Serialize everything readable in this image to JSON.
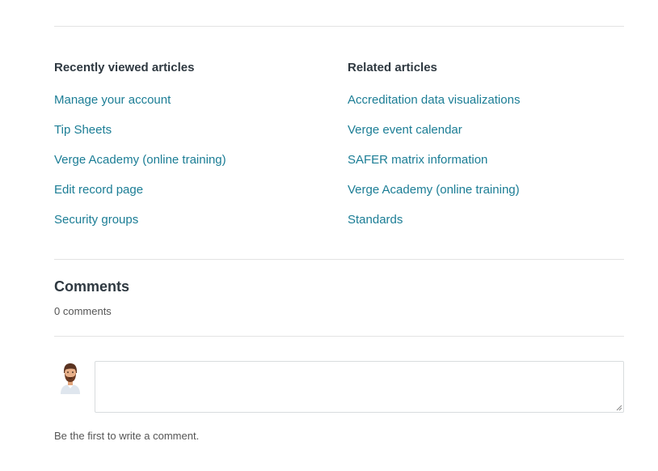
{
  "recently_viewed": {
    "heading": "Recently viewed articles",
    "items": [
      {
        "label": "Manage your account"
      },
      {
        "label": "Tip Sheets"
      },
      {
        "label": "Verge Academy (online training)"
      },
      {
        "label": "Edit record page"
      },
      {
        "label": "Security groups"
      }
    ]
  },
  "related": {
    "heading": "Related articles",
    "items": [
      {
        "label": "Accreditation data visualizations"
      },
      {
        "label": "Verge event calendar"
      },
      {
        "label": "SAFER matrix information"
      },
      {
        "label": "Verge Academy (online training)"
      },
      {
        "label": "Standards"
      }
    ]
  },
  "comments": {
    "title": "Comments",
    "count": "0 comments",
    "input_value": "",
    "empty_message": "Be the first to write a comment."
  },
  "colors": {
    "link": "#1b7d95",
    "heading": "#2f3941",
    "divider": "#e3e3e3"
  },
  "icons": {
    "avatar": "user-avatar-icon"
  }
}
